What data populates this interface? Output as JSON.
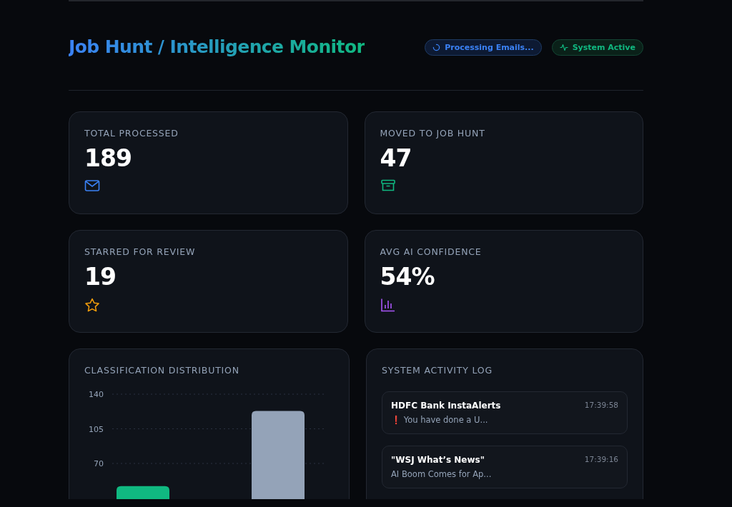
{
  "header": {
    "title": "Job Hunt / Intelligence Monitor",
    "badges": [
      {
        "kind": "processing",
        "label": "Processing Emails..."
      },
      {
        "kind": "active",
        "label": "System Active"
      }
    ]
  },
  "stats": [
    {
      "label": "TOTAL PROCESSED",
      "value": "189",
      "kind": "mail"
    },
    {
      "label": "MOVED TO JOB HUNT",
      "value": "47",
      "kind": "archive"
    },
    {
      "label": "STARRED FOR REVIEW",
      "value": "19",
      "kind": "star"
    },
    {
      "label": "AVG AI CONFIDENCE",
      "value": "54%",
      "kind": "chart"
    }
  ],
  "distribution": {
    "title": "CLASSIFICATION DISTRIBUTION",
    "chart_data": {
      "type": "bar",
      "ylim": [
        0,
        140
      ],
      "yticks": [
        70,
        105,
        140
      ],
      "series": [
        {
          "color": "#10b981",
          "values": [
            47,
            null
          ]
        },
        {
          "color": "#94a3b8",
          "values": [
            null,
            123
          ]
        }
      ]
    }
  },
  "activity_log": {
    "title": "SYSTEM ACTIVITY LOG",
    "entries": [
      {
        "sender": "HDFC Bank InstaAlerts",
        "time": "17:39:58",
        "preview": "❗ You have done a U..."
      },
      {
        "sender": "\"WSJ What’s News\"",
        "time": "17:39:16",
        "preview": "AI Boom Comes for Ap..."
      }
    ]
  }
}
